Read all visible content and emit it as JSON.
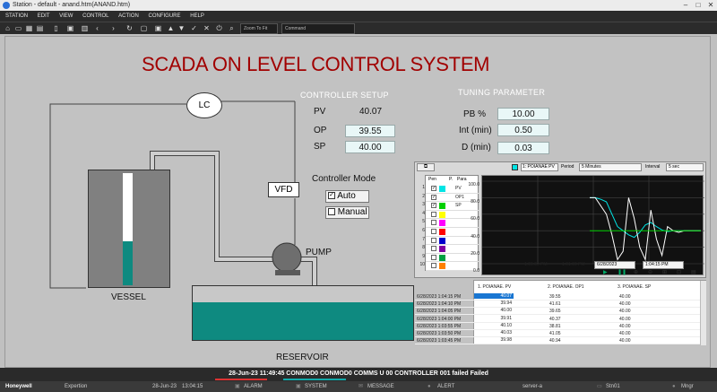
{
  "window": {
    "title": "Station - default - anand.htm(ANAND.htm)"
  },
  "menu": [
    "STATION",
    "EDIT",
    "VIEW",
    "CONTROL",
    "ACTION",
    "CONFIGURE",
    "HELP"
  ],
  "toolbar": {
    "zoom": "Zoom To Fit",
    "command": "Command"
  },
  "display": {
    "title": "SCADA ON LEVEL CONTROL SYSTEM",
    "lc_label": "LC",
    "vfd_label": "VFD",
    "pump_label": "PUMP",
    "vessel_label": "VESSEL",
    "reservoir_label": "RESERVOIR",
    "vessel_level": 0.39,
    "controller_header": "CONTROLLER SETUP",
    "pv_label": "PV",
    "pv_value": "40.07",
    "op_label": "OP",
    "op_value": "39.55",
    "sp_label": "SP",
    "sp_value": "40.00",
    "tuning_header": "TUNING PARAMETER",
    "pb_label": "PB %",
    "pb_value": "10.00",
    "int_label": "Int (min)",
    "int_value": "0.50",
    "d_label": "D (min)",
    "d_value": "0.03",
    "mode_title": "Controller Mode",
    "mode_auto": "Auto",
    "mode_manual": "Manual"
  },
  "trend": {
    "pen_label": "Pen",
    "pen_p": "P.",
    "pen_param": "Para",
    "pens": [
      {
        "num": "1",
        "color": "#00e5e5",
        "label": "PV",
        "checked": true
      },
      {
        "num": "2",
        "color": "#ffffff",
        "label": "OP1",
        "checked": true
      },
      {
        "num": "3",
        "color": "#00d000",
        "label": "SP",
        "checked": true
      },
      {
        "num": "4",
        "color": "#ffff00",
        "label": "",
        "checked": false
      },
      {
        "num": "5",
        "color": "#ff00ff",
        "label": "",
        "checked": false
      },
      {
        "num": "6",
        "color": "#ff0000",
        "label": "",
        "checked": false
      },
      {
        "num": "7",
        "color": "#0000cc",
        "label": "",
        "checked": false
      },
      {
        "num": "8",
        "color": "#8000a0",
        "label": "",
        "checked": false
      },
      {
        "num": "9",
        "color": "#00a040",
        "label": "",
        "checked": false
      },
      {
        "num": "10",
        "color": "#ff8000",
        "label": "",
        "checked": false
      }
    ],
    "selected_pen": "1: POIANAE PV",
    "period_label": "Period",
    "period_value": "5 Minutes",
    "interval_label": "Interval",
    "interval_value": "5 sec",
    "y_ticks": [
      "100.0",
      "80.0",
      "60.0",
      "40.0",
      "20.0",
      "0.0"
    ],
    "x_ticks": [
      "1:00:00 PM",
      "1:01:00 PM",
      "1:02:00 PM"
    ],
    "date": "6/28/2023",
    "time": "1:04:15 PM"
  },
  "chart_data": {
    "type": "line",
    "xlabel": "",
    "ylabel": "",
    "ylim": [
      0,
      100
    ],
    "x_label_ticks": [
      "1:00:00 PM",
      "1:01:00 PM",
      "1:02:00 PM"
    ],
    "series": [
      {
        "name": "PV",
        "color": "#00e5e5",
        "x": [
          0,
          1,
          2,
          3,
          4,
          5,
          6,
          7,
          8,
          9,
          10,
          11,
          12,
          13,
          14,
          15,
          16,
          17,
          18,
          19,
          20
        ],
        "values": [
          80,
          80,
          78,
          75,
          60,
          45,
          40,
          35,
          32,
          38,
          47,
          50,
          45,
          41,
          39,
          40,
          40,
          40,
          40,
          40,
          40
        ]
      },
      {
        "name": "OP1",
        "color": "#ffffff",
        "x": [
          0,
          1,
          2,
          3,
          4,
          5,
          6,
          7,
          8,
          9,
          10,
          11,
          12,
          13,
          14,
          15,
          16,
          17,
          18,
          19,
          20
        ],
        "values": [
          80,
          80,
          70,
          60,
          35,
          5,
          15,
          80,
          55,
          20,
          5,
          65,
          30,
          10,
          45,
          40,
          38,
          40,
          40,
          40,
          40
        ]
      },
      {
        "name": "SP",
        "color": "#00d000",
        "x": [
          0,
          1,
          2,
          3,
          4,
          5,
          6,
          7,
          8,
          9,
          10,
          11,
          12,
          13,
          14,
          15,
          16,
          17,
          18,
          19,
          20
        ],
        "values": [
          40,
          40,
          40,
          40,
          40,
          40,
          40,
          40,
          40,
          40,
          40,
          40,
          40,
          40,
          40,
          40,
          40,
          40,
          40,
          40,
          40
        ]
      }
    ]
  },
  "grid": {
    "headers": [
      "1. POIANAE. PV",
      "2. POIANAE. OP1",
      "3. POIANAE. SP"
    ],
    "rows": [
      {
        "time": "6/28/2023 1:04:15 PM",
        "pv": "40.07",
        "op": "39.55",
        "sp": "40.00"
      },
      {
        "time": "6/28/2023 1:04:10 PM",
        "pv": "39.94",
        "op": "41.61",
        "sp": "40.00"
      },
      {
        "time": "6/28/2023 1:04:05 PM",
        "pv": "40.00",
        "op": "39.65",
        "sp": "40.00"
      },
      {
        "time": "6/28/2023 1:04:00 PM",
        "pv": "39.91",
        "op": "40.37",
        "sp": "40.00"
      },
      {
        "time": "6/28/2023 1:03:55 PM",
        "pv": "40.10",
        "op": "38.81",
        "sp": "40.00"
      },
      {
        "time": "6/28/2023 1:03:50 PM",
        "pv": "40.03",
        "op": "41.05",
        "sp": "40.00"
      },
      {
        "time": "6/28/2023 1:03:45 PM",
        "pv": "39.98",
        "op": "40.94",
        "sp": "40.00"
      }
    ]
  },
  "status": {
    "alarm_line": "28-Jun-23  11:49:45  CONMOD0   CONMOD0   COMMS   U 00 CONTROLLER 001 failed   Failed",
    "brand": "Honeywell",
    "mode": "Expertion",
    "date": "28-Jun-23",
    "time": "13:04:15",
    "alarm": "ALARM",
    "system": "SYSTEM",
    "message": "MESSAGE",
    "alert": "ALERT",
    "server": "server-a",
    "station": "Stn01",
    "user": "Mngr"
  }
}
